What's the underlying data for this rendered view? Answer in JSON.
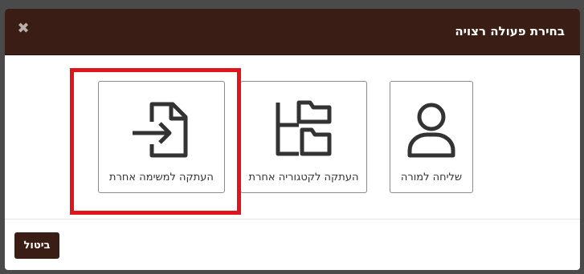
{
  "modal": {
    "title": "בחירת פעולה רצויה",
    "close_icon": "close-icon"
  },
  "actions": [
    {
      "label": "שליחה למורה",
      "icon": "user-icon"
    },
    {
      "label": "העתקה לקטגוריה אחרת",
      "icon": "folder-tree-icon"
    },
    {
      "label": "העתקה למשימה אחרת",
      "icon": "file-import-icon",
      "highlighted": true
    }
  ],
  "footer": {
    "cancel_label": "ביטול"
  },
  "colors": {
    "header_bg": "#3a1d14",
    "highlight": "#e0141b",
    "icon": "#333333"
  }
}
